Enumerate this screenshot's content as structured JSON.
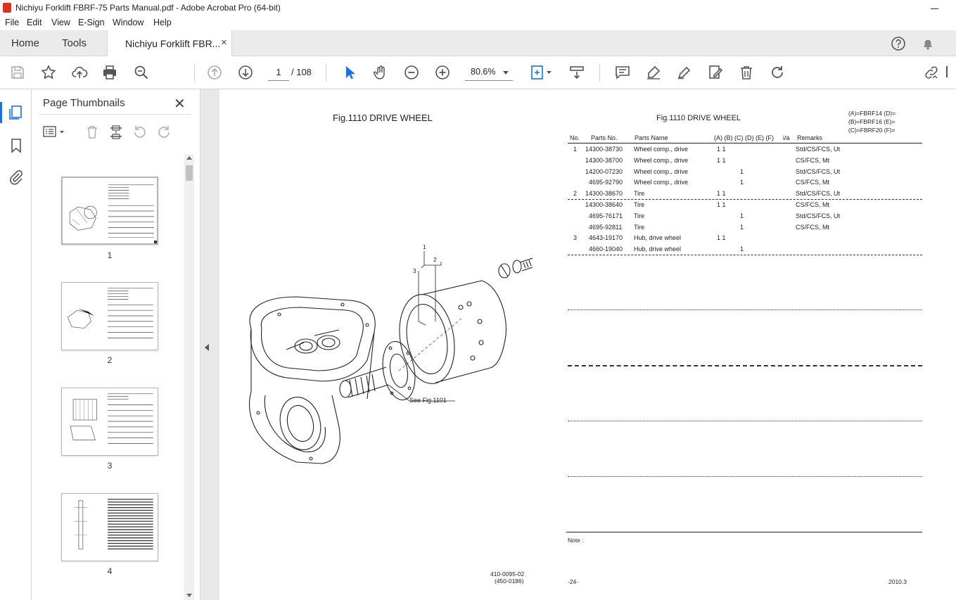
{
  "window": {
    "title": "Nichiyu Forklift FBRF-75 Parts Manual.pdf - Adobe Acrobat Pro (64-bit)"
  },
  "menu": [
    "File",
    "Edit",
    "View",
    "E-Sign",
    "Window",
    "Help"
  ],
  "tabs": {
    "home": "Home",
    "tools": "Tools",
    "document": "Nichiyu Forklift FBR...",
    "close": "×"
  },
  "toolbar": {
    "current_page": "1",
    "total_pages": "/ 108",
    "zoom": "80.6%"
  },
  "thumbnails_panel": {
    "title": "Page Thumbnails",
    "close": "✕",
    "pages": [
      "1",
      "2",
      "3",
      "4"
    ]
  },
  "page": {
    "fig_title_left": "Fig.1110  DRIVE WHEEL",
    "fig_title_right": "Fig.1110  DRIVE WHEEL",
    "legend": [
      "(A)=FBRF14  (D)=",
      "(B)=FBRF16  (E)=",
      "(C)=FBRF20  (F)="
    ],
    "headers": {
      "no": "No.",
      "parts_no": "Parts No.",
      "parts_name": "Parts Name",
      "models": "(A) (B) (C) (D) (E) (F)",
      "ia": "i/a",
      "remarks": "Remarks"
    },
    "rows": [
      {
        "no": "1",
        "parts_no": "14300-38730",
        "name": "Wheel comp., drive",
        "qty": "1    1",
        "remarks": "Std/CS/FCS, Ut"
      },
      {
        "no": "",
        "parts_no": "14300-38700",
        "name": "Wheel comp., drive",
        "qty": "1    1",
        "remarks": "CS/FCS, Mt"
      },
      {
        "no": "",
        "parts_no": "14200-07230",
        "name": "Wheel comp., drive",
        "qty": "1",
        "remarks": "Std/CS/FCS, Ut"
      },
      {
        "no": "",
        "parts_no": "4695-92790",
        "name": "Wheel comp., drive",
        "qty": "1",
        "remarks": "CS/FCS, Mt"
      },
      {
        "no": "2",
        "parts_no": "14300-38670",
        "name": "Tire",
        "qty": "1    1",
        "remarks": "Std/CS/FCS, Ut"
      },
      {
        "no": "",
        "parts_no": "14300-38640",
        "name": "Tire",
        "qty": "1    1",
        "remarks": "CS/FCS, Mt"
      },
      {
        "no": "",
        "parts_no": "4695-76171",
        "name": "Tire",
        "qty": "1",
        "remarks": "Std/CS/FCS, Ut"
      },
      {
        "no": "",
        "parts_no": "4695-92811",
        "name": "Tire",
        "qty": "1",
        "remarks": "CS/FCS, Mt"
      },
      {
        "no": "3",
        "parts_no": "4643-19170",
        "name": "Hub, drive wheel",
        "qty": "1    1",
        "remarks": ""
      },
      {
        "no": "",
        "parts_no": "4660-19040",
        "name": "Hub, drive wheel",
        "qty": "1",
        "remarks": ""
      }
    ],
    "callouts": {
      "c1": "1",
      "c2": "2",
      "c3": "3",
      "see": "See Fig.1101"
    },
    "note": "Note :",
    "drawing_no": "410-0095-02",
    "drawing_ref": "(450-0186)",
    "page_num": "-24-",
    "date": "2010.3"
  }
}
